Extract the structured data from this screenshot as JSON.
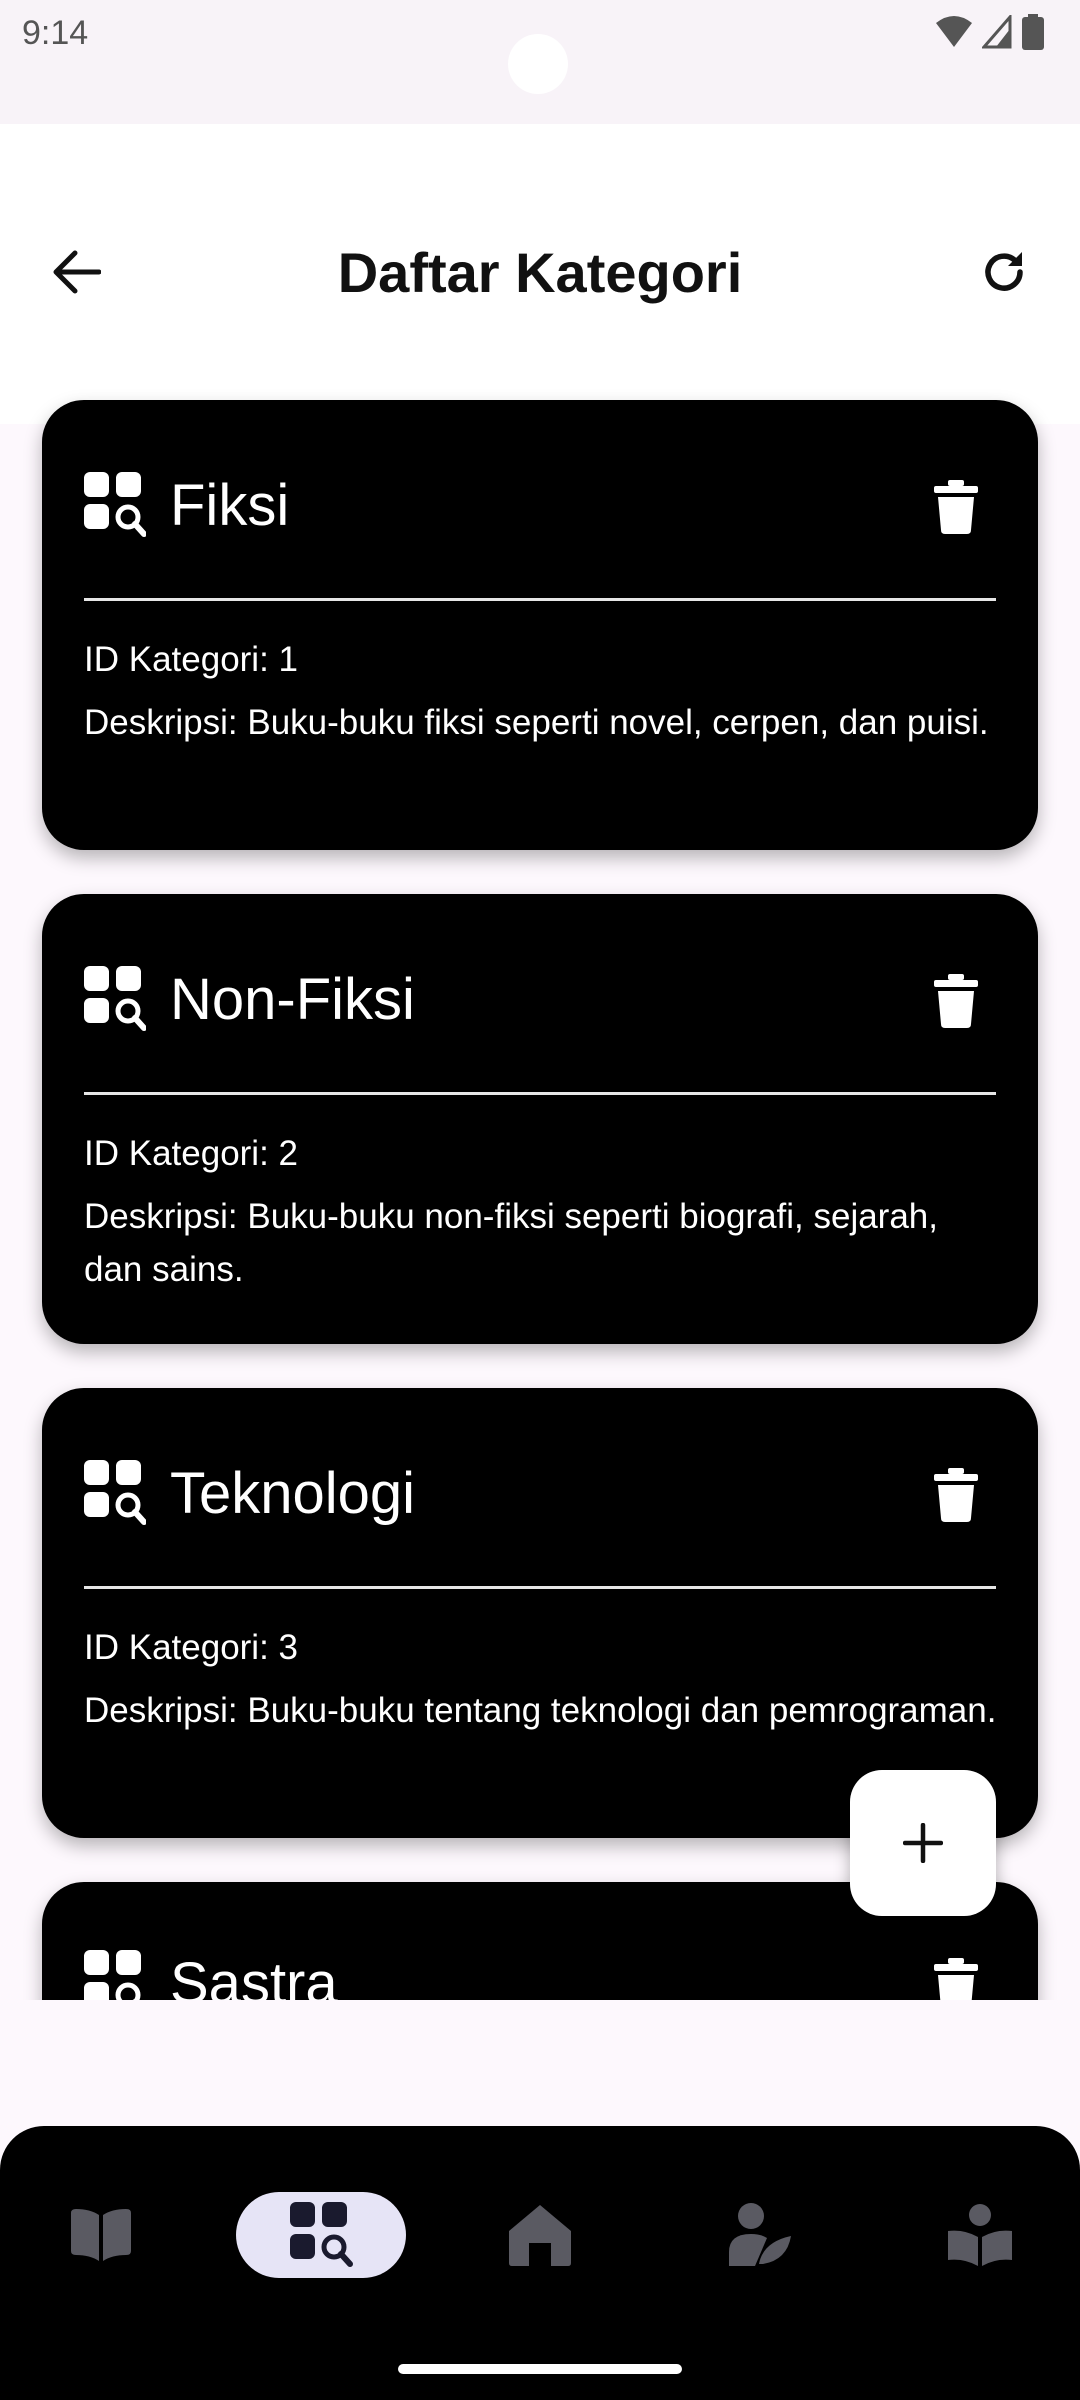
{
  "status_bar": {
    "time": "9:14"
  },
  "header": {
    "title": "Daftar Kategori"
  },
  "categories": [
    {
      "name": "Fiksi",
      "id_text": "ID Kategori: 1",
      "desc_text": "Deskripsi: Buku-buku fiksi seperti novel, cerpen, dan puisi."
    },
    {
      "name": "Non-Fiksi",
      "id_text": "ID Kategori: 2",
      "desc_text": "Deskripsi: Buku-buku non-fiksi seperti biografi, sejarah, dan sains."
    },
    {
      "name": "Teknologi",
      "id_text": "ID Kategori: 3",
      "desc_text": "Deskripsi: Buku-buku tentang teknologi dan pemrograman."
    },
    {
      "name": "Sastra"
    }
  ],
  "fab": {
    "icon": "plus-icon"
  },
  "bottom_nav": {
    "items": [
      {
        "icon": "book-icon",
        "active": false
      },
      {
        "icon": "category-search-icon",
        "active": true
      },
      {
        "icon": "home-icon",
        "active": false
      },
      {
        "icon": "author-icon",
        "active": false
      },
      {
        "icon": "reader-icon",
        "active": false
      }
    ]
  },
  "colors": {
    "card_bg": "#000000",
    "nav_active_pill": "#e6e4f6",
    "nav_icon_inactive": "#5a5a62",
    "nav_icon_active": "#1a1a2e"
  }
}
